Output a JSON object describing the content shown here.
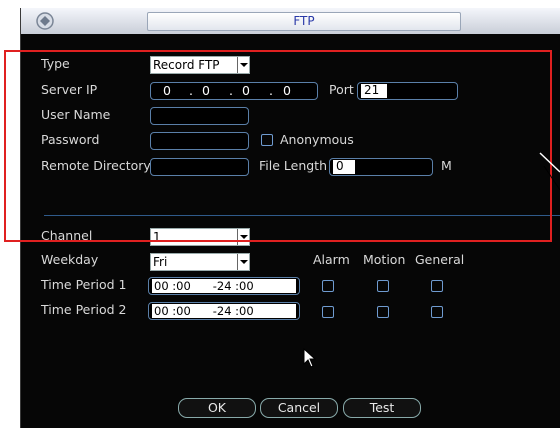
{
  "window": {
    "title": "FTP"
  },
  "colors": {
    "frame": "#e02020",
    "accent": "#2a3aa8"
  },
  "form": {
    "type_label": "Type",
    "type_value": "Record FTP",
    "server_ip_label": "Server IP",
    "ip": [
      "0",
      "0",
      "0",
      "0"
    ],
    "port_label": "Port",
    "port_value": "21",
    "user_name_label": "User Name",
    "password_label": "Password",
    "anonymous_label": "Anonymous",
    "remote_dir_label": "Remote Directory",
    "file_length_label": "File Length",
    "file_length_value": "0",
    "file_length_unit": "M"
  },
  "schedule": {
    "channel_label": "Channel",
    "channel_value": "1",
    "weekday_label": "Weekday",
    "weekday_value": "Fri",
    "col_alarm": "Alarm",
    "col_motion": "Motion",
    "col_general": "General",
    "periods": [
      {
        "label": "Time Period 1",
        "value": "00 :00      -24 :00"
      },
      {
        "label": "Time Period 2",
        "value": "00 :00      -24 :00"
      }
    ]
  },
  "buttons": {
    "ok": "OK",
    "cancel": "Cancel",
    "test": "Test"
  }
}
